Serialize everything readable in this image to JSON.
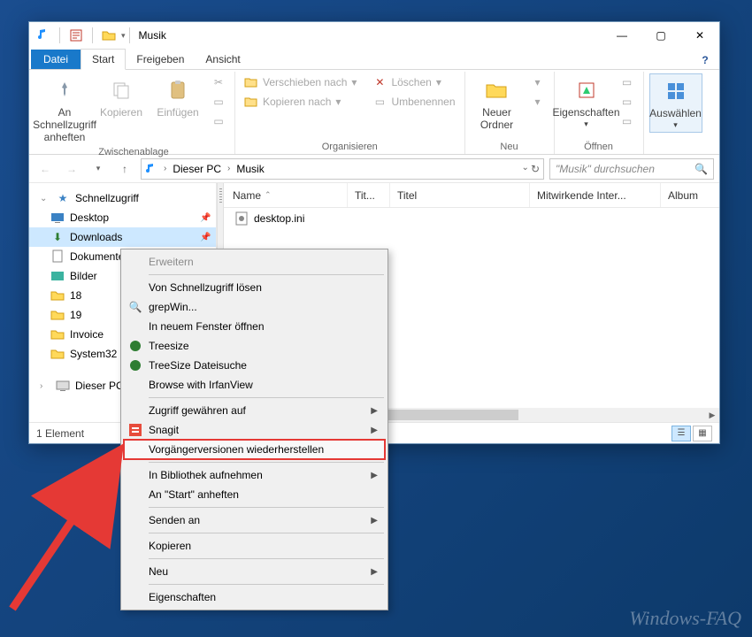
{
  "window": {
    "title": "Musik",
    "controls": {
      "minimize": "—",
      "maximize": "▢",
      "close": "✕"
    }
  },
  "tabs": {
    "file": "Datei",
    "items": [
      "Start",
      "Freigeben",
      "Ansicht"
    ],
    "active": 0
  },
  "ribbon": {
    "clipboard": {
      "label": "Zwischenablage",
      "pin": "An Schnellzugriff anheften",
      "copy": "Kopieren",
      "paste": "Einfügen"
    },
    "organize": {
      "label": "Organisieren",
      "moveto": "Verschieben nach",
      "copyto": "Kopieren nach",
      "delete": "Löschen",
      "rename": "Umbenennen"
    },
    "new": {
      "label": "Neu",
      "newfolder": "Neuer Ordner"
    },
    "open": {
      "label": "Öffnen",
      "properties": "Eigenschaften"
    },
    "select": {
      "label": "Auswählen",
      "select": "Auswählen"
    }
  },
  "address": {
    "crumbs": [
      "Dieser PC",
      "Musik"
    ]
  },
  "search": {
    "placeholder": "\"Musik\" durchsuchen"
  },
  "nav": {
    "quick": "Schnellzugriff",
    "items": [
      "Desktop",
      "Downloads",
      "Dokumente",
      "Bilder",
      "18",
      "19",
      "Invoice",
      "System32"
    ],
    "selected": 1,
    "pc": "Dieser PC"
  },
  "columns": {
    "name": "Name",
    "tit": "Tit...",
    "titel": "Titel",
    "mit": "Mitwirkende Inter...",
    "album": "Album"
  },
  "files": [
    {
      "name": "desktop.ini"
    }
  ],
  "status": {
    "count": "1 Element"
  },
  "context": {
    "expand": "Erweitern",
    "unpin": "Von Schnellzugriff lösen",
    "grepwin": "grepWin...",
    "newwin": "In neuem Fenster öffnen",
    "treesize": "Treesize",
    "treesearch": "TreeSize Dateisuche",
    "irfan": "Browse with IrfanView",
    "access": "Zugriff gewähren auf",
    "snagit": "Snagit",
    "restore": "Vorgängerversionen wiederherstellen",
    "library": "In Bibliothek aufnehmen",
    "startpin": "An \"Start\" anheften",
    "sendto": "Senden an",
    "copy": "Kopieren",
    "new": "Neu",
    "props": "Eigenschaften"
  },
  "watermark": "Windows-FAQ"
}
